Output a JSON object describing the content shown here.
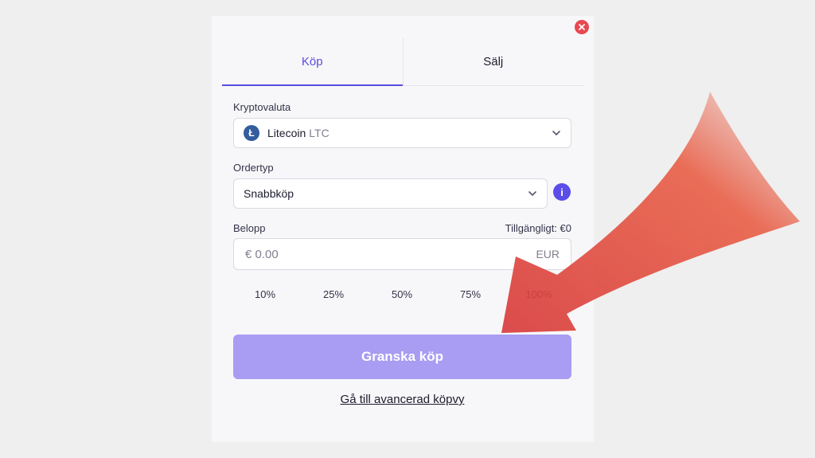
{
  "tabs": [
    {
      "label": "Köp",
      "active": true
    },
    {
      "label": "Sälj",
      "active": false
    }
  ],
  "crypto": {
    "label": "Kryptovaluta",
    "name": "Litecoin",
    "ticker": "LTC",
    "icon_letter": "Ł"
  },
  "order": {
    "label": "Ordertyp",
    "value": "Snabbköp",
    "info_icon": "i"
  },
  "amount": {
    "label": "Belopp",
    "available": "Tillgängligt: €0",
    "value": "€ 0.00",
    "currency": "EUR"
  },
  "percentages": [
    "10%",
    "25%",
    "50%",
    "75%",
    "100%"
  ],
  "cta": {
    "label": "Granska köp"
  },
  "advanced_link": "Gå till avancerad köpvy",
  "colors": {
    "accent": "#5a4de0",
    "button": "#a89cf3",
    "close": "#e8484f",
    "arrow": "#e0453c"
  }
}
